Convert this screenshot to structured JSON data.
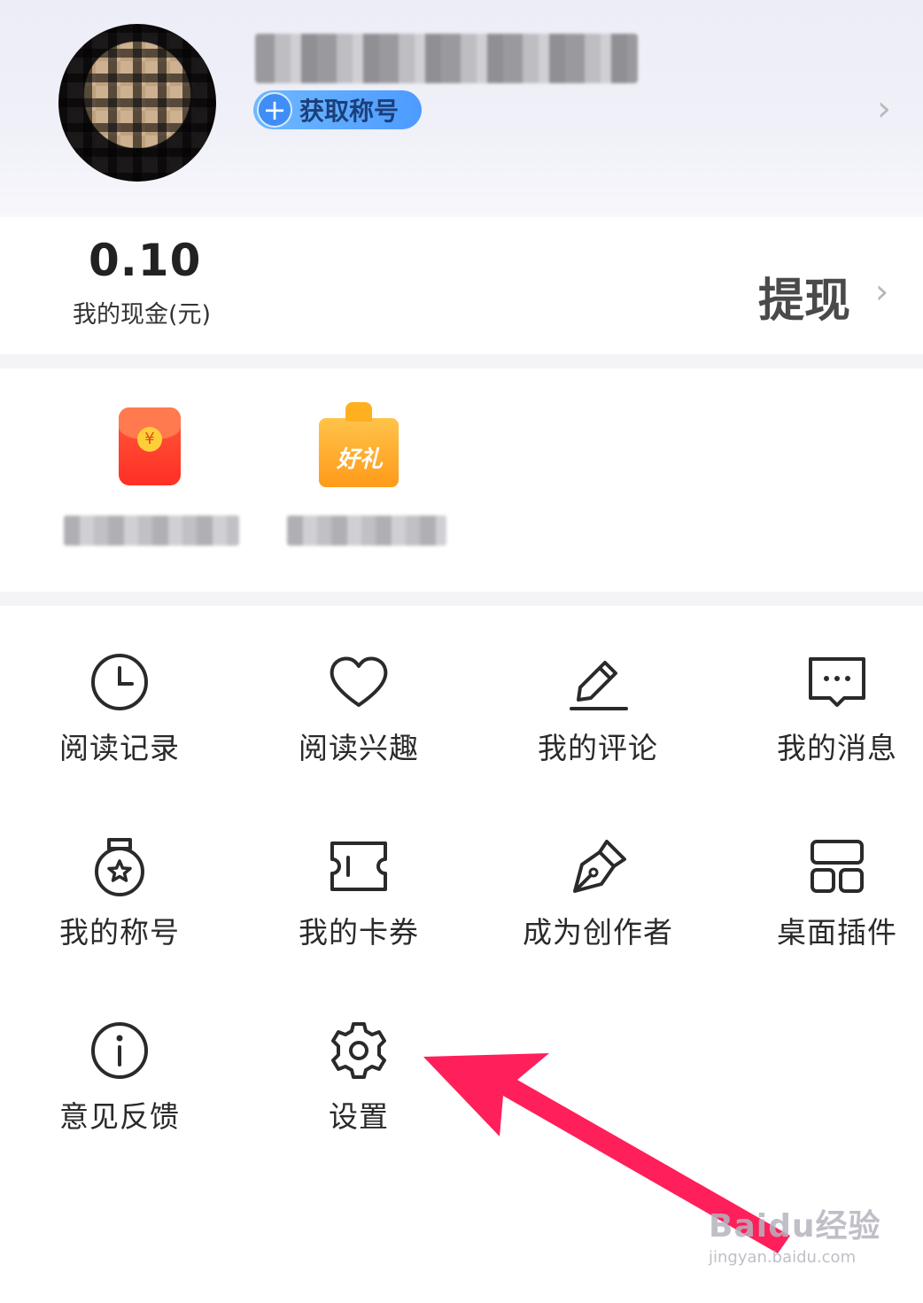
{
  "profile": {
    "get_title_label": "获取称号",
    "plus_icon": "plus-icon",
    "chevron_icon": "chevron-right-icon"
  },
  "wallet": {
    "cash_value": "0.10",
    "cash_label": "我的现金(元)",
    "withdraw_label": "提现"
  },
  "promos": [
    {
      "icon": "red-packet-icon",
      "coin_symbol": "¥"
    },
    {
      "icon": "gift-box-icon",
      "icon_text": "好礼"
    }
  ],
  "menu": [
    {
      "label": "阅读记录",
      "icon": "clock-icon"
    },
    {
      "label": "阅读兴趣",
      "icon": "heart-icon"
    },
    {
      "label": "我的评论",
      "icon": "pencil-icon"
    },
    {
      "label": "我的消息",
      "icon": "message-icon"
    },
    {
      "label": "我的称号",
      "icon": "medal-icon"
    },
    {
      "label": "我的卡券",
      "icon": "ticket-icon"
    },
    {
      "label": "成为创作者",
      "icon": "pen-nib-icon"
    },
    {
      "label": "桌面插件",
      "icon": "widget-icon"
    },
    {
      "label": "意见反馈",
      "icon": "info-icon"
    },
    {
      "label": "设置",
      "icon": "gear-icon"
    }
  ],
  "annotation": {
    "color": "#ff1f5a"
  },
  "watermark": {
    "brand": "Baidu经验",
    "url": "jingyan.baidu.com"
  },
  "colors": {
    "badge_blue": "#4c9bff",
    "red_packet": "#ff2f25",
    "gift_orange": "#ff9a1a"
  }
}
